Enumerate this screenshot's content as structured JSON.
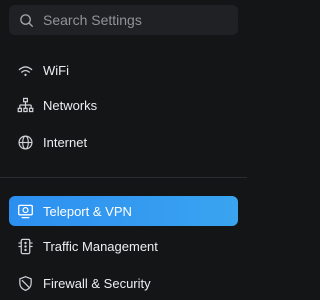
{
  "search": {
    "placeholder": "Search Settings",
    "value": ""
  },
  "nav": {
    "items": [
      {
        "label": "WiFi",
        "icon": "wifi-icon"
      },
      {
        "label": "Networks",
        "icon": "networks-icon"
      },
      {
        "label": "Internet",
        "icon": "globe-icon"
      },
      {
        "label": "Teleport & VPN",
        "icon": "teleport-vpn-icon",
        "active": true
      },
      {
        "label": "Traffic Management",
        "icon": "traffic-management-icon"
      },
      {
        "label": "Firewall & Security",
        "icon": "shield-icon"
      }
    ]
  },
  "colors": {
    "background": "#141517",
    "search_background": "#1f2124",
    "active_accent": "#2c8ff0",
    "text": "#eceef2"
  }
}
